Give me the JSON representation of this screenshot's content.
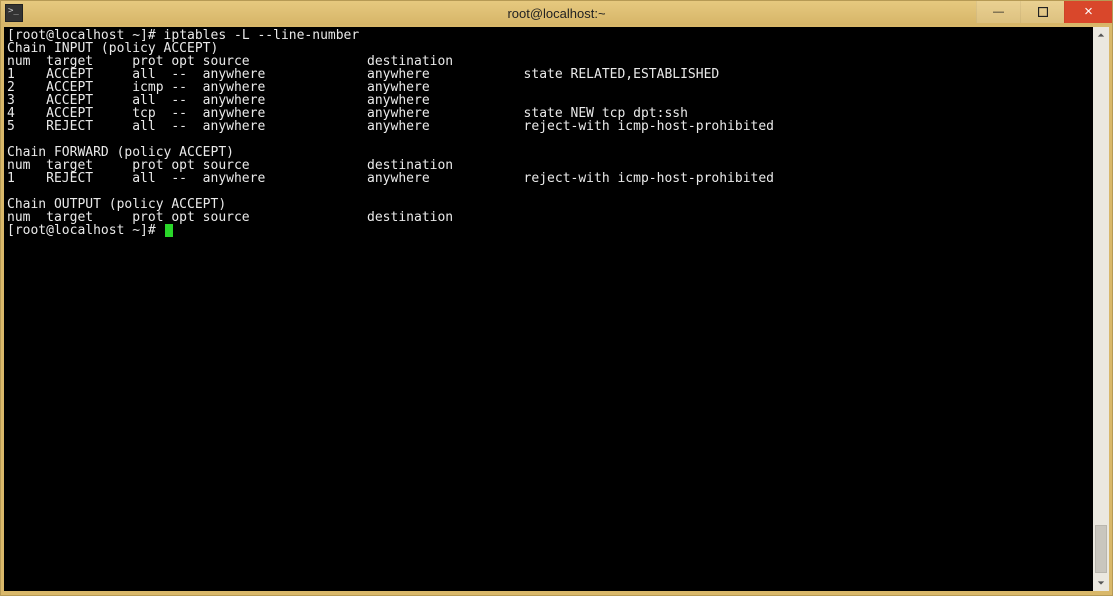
{
  "window": {
    "title": "root@localhost:~"
  },
  "controls": {
    "minimize_glyph": "—",
    "close_glyph": "×"
  },
  "terminal": {
    "prompt1": "[root@localhost ~]# ",
    "command1": "iptables -L --line-number",
    "chains": {
      "input": {
        "header": "Chain INPUT (policy ACCEPT)",
        "col_header": "num  target     prot opt source               destination",
        "rows": [
          "1    ACCEPT     all  --  anywhere             anywhere            state RELATED,ESTABLISHED",
          "2    ACCEPT     icmp --  anywhere             anywhere",
          "3    ACCEPT     all  --  anywhere             anywhere",
          "4    ACCEPT     tcp  --  anywhere             anywhere            state NEW tcp dpt:ssh",
          "5    REJECT     all  --  anywhere             anywhere            reject-with icmp-host-prohibited"
        ]
      },
      "forward": {
        "header": "Chain FORWARD (policy ACCEPT)",
        "col_header": "num  target     prot opt source               destination",
        "rows": [
          "1    REJECT     all  --  anywhere             anywhere            reject-with icmp-host-prohibited"
        ]
      },
      "output": {
        "header": "Chain OUTPUT (policy ACCEPT)",
        "col_header": "num  target     prot opt source               destination"
      }
    },
    "prompt2": "[root@localhost ~]# "
  }
}
